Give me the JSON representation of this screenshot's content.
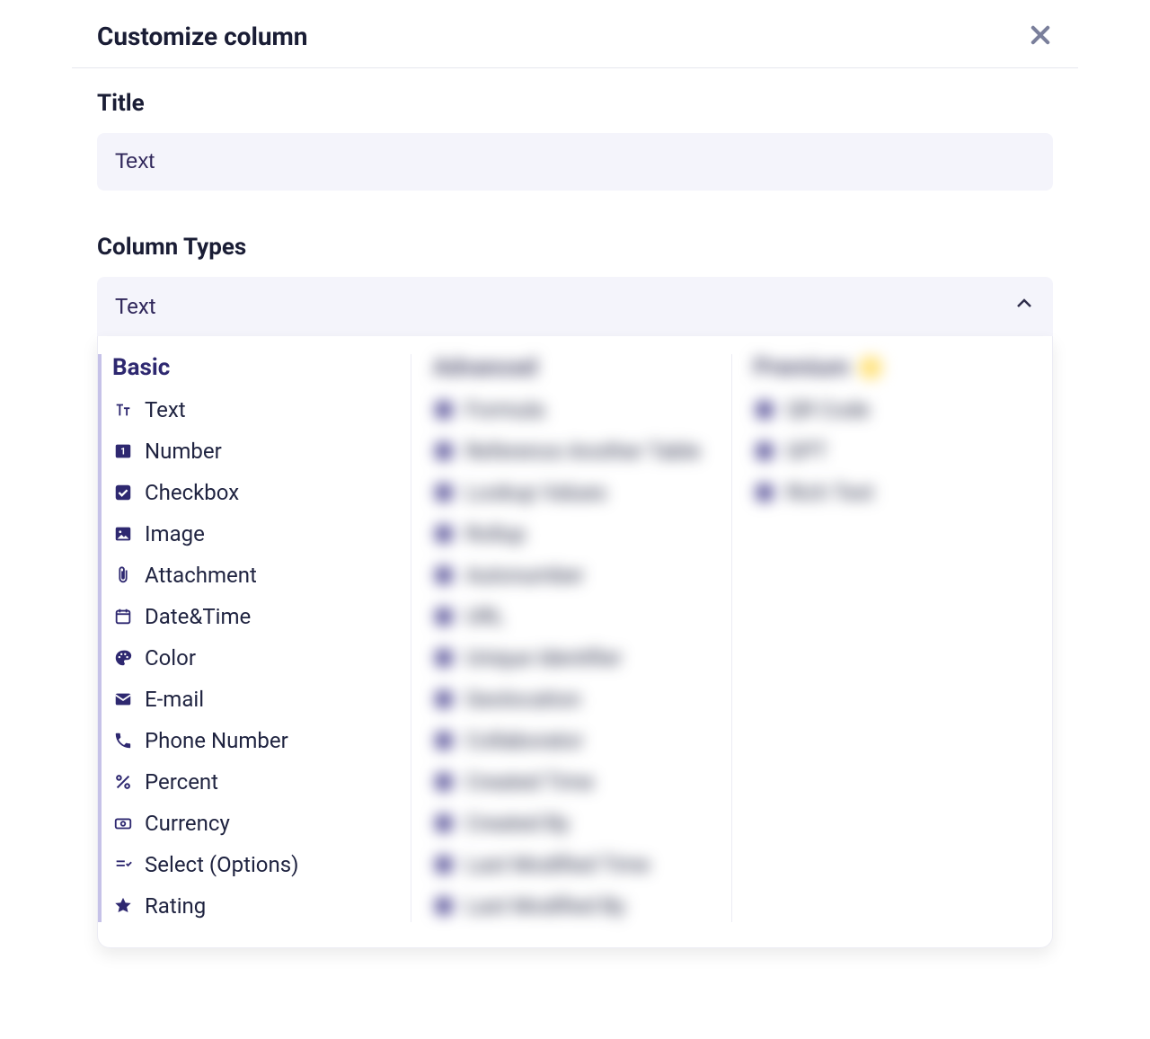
{
  "dialog": {
    "title": "Customize column"
  },
  "titleSection": {
    "label": "Title",
    "value": "Text"
  },
  "columnTypes": {
    "label": "Column Types",
    "selected": "Text",
    "groups": {
      "basic": {
        "title": "Basic",
        "items": [
          {
            "icon": "text-icon",
            "label": "Text"
          },
          {
            "icon": "number-icon",
            "label": "Number"
          },
          {
            "icon": "checkbox-icon",
            "label": "Checkbox"
          },
          {
            "icon": "image-icon",
            "label": "Image"
          },
          {
            "icon": "attachment-icon",
            "label": "Attachment"
          },
          {
            "icon": "datetime-icon",
            "label": "Date&Time"
          },
          {
            "icon": "color-icon",
            "label": "Color"
          },
          {
            "icon": "email-icon",
            "label": "E-mail"
          },
          {
            "icon": "phone-icon",
            "label": "Phone Number"
          },
          {
            "icon": "percent-icon",
            "label": "Percent"
          },
          {
            "icon": "currency-icon",
            "label": "Currency"
          },
          {
            "icon": "select-icon",
            "label": "Select (Options)"
          },
          {
            "icon": "rating-icon",
            "label": "Rating"
          }
        ]
      },
      "advanced": {
        "title": "Advanced",
        "items": [
          {
            "label": "Formula"
          },
          {
            "label": "Reference Another Table"
          },
          {
            "label": "Lookup Values"
          },
          {
            "label": "Rollup"
          },
          {
            "label": "Autonumber"
          },
          {
            "label": "URL"
          },
          {
            "label": "Unique Identifier"
          },
          {
            "label": "Geolocation"
          },
          {
            "label": "Collaborator"
          },
          {
            "label": "Created Time"
          },
          {
            "label": "Created By"
          },
          {
            "label": "Last Modified Time"
          },
          {
            "label": "Last Modified By"
          }
        ]
      },
      "premium": {
        "title": "Premium",
        "items": [
          {
            "label": "QR Code"
          },
          {
            "label": "GPT"
          },
          {
            "label": "Rich Text"
          }
        ]
      }
    }
  }
}
